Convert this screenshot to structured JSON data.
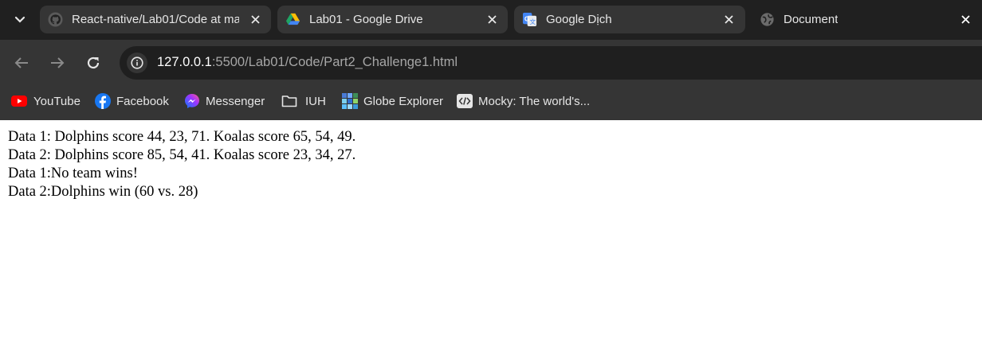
{
  "tabs": [
    {
      "title": "React-native/Lab01/Code at ma",
      "icon": "github-icon",
      "active": false
    },
    {
      "title": "Lab01 - Google Drive",
      "icon": "google-drive-icon",
      "active": false
    },
    {
      "title": "Google Dịch",
      "icon": "google-translate-icon",
      "active": false
    },
    {
      "title": "Document",
      "icon": "globe-icon",
      "active": true
    }
  ],
  "toolbar": {
    "url_host": "127.0.0.1",
    "url_path": ":5500/Lab01/Code/Part2_Challenge1.html"
  },
  "bookmarks": [
    {
      "label": "YouTube",
      "icon": "youtube-icon"
    },
    {
      "label": "Facebook",
      "icon": "facebook-icon"
    },
    {
      "label": "Messenger",
      "icon": "messenger-icon"
    },
    {
      "label": "IUH",
      "icon": "folder-icon"
    },
    {
      "label": "Globe Explorer",
      "icon": "globe-explorer-icon"
    },
    {
      "label": "Mocky: The world's...",
      "icon": "mocky-icon"
    }
  ],
  "page": {
    "lines": [
      "Data 1: Dolphins score 44, 23, 71. Koalas score 65, 54, 49.",
      "Data 2: Dolphins score 85, 54, 41. Koalas score 23, 34, 27.",
      "Data 1:No team wins!",
      "Data 2:Dolphins win (60 vs. 28)"
    ]
  },
  "colors": {
    "tabstrip": "#202020",
    "toolbar": "#353535",
    "omnibox": "#1f1f1f",
    "page_bg": "#ffffff"
  }
}
